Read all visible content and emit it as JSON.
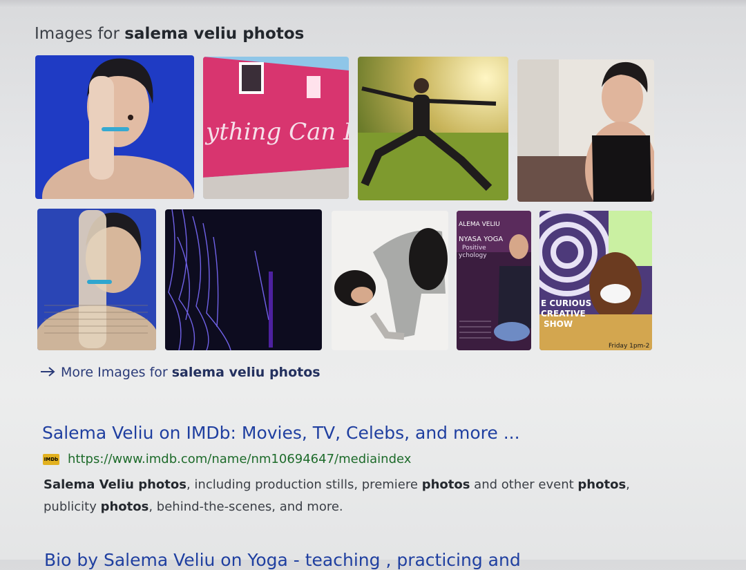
{
  "images_section": {
    "heading_prefix": "Images for ",
    "heading_query": "salema veliu photos",
    "thumbnails": [
      {
        "desc": "woman-hand-over-eye-blue"
      },
      {
        "desc": "pink-wall-mural",
        "text": "ything Can Happen"
      },
      {
        "desc": "yoga-warrior-pose-sunlight"
      },
      {
        "desc": "woman-black-tank-top"
      },
      {
        "desc": "collage-woman-newspaper"
      },
      {
        "desc": "purple-fiber-lights"
      },
      {
        "desc": "yoga-crow-pose-patterned"
      },
      {
        "desc": "vinyasa-yoga-poster",
        "lines": [
          "ALEMA VELIU",
          "NYASA YOGA",
          "Positive",
          "ychology"
        ]
      },
      {
        "desc": "curious-creative-show-poster",
        "lines": [
          "E CURIOUS",
          "CREATIVE",
          "SHOW",
          "Friday 1pm-2"
        ]
      }
    ],
    "more_link_prefix": "More Images for ",
    "more_link_query": "salema veliu photos"
  },
  "result": {
    "title": "Salema Veliu on IMDb: Movies, TV, Celebs, and more ...",
    "favicon_text": "IMDb",
    "url": "https://www.imdb.com/name/nm10694647/mediaindex",
    "snippet_parts": [
      {
        "text": "Salema Veliu photos",
        "bold": true
      },
      {
        "text": ", including production stills, premiere ",
        "bold": false
      },
      {
        "text": "photos",
        "bold": true
      },
      {
        "text": " and other event ",
        "bold": false
      },
      {
        "text": "photos",
        "bold": true
      },
      {
        "text": ", publicity ",
        "bold": false
      },
      {
        "text": "photos",
        "bold": true
      },
      {
        "text": ", behind-the-scenes, and more.",
        "bold": false
      }
    ]
  },
  "next_result": {
    "title": "Bio by Salema Veliu on Yoga - teaching , practicing and"
  },
  "colors": {
    "link": "#1f3fa0",
    "url": "#1d6b2a",
    "background": "#e6e7e9"
  }
}
